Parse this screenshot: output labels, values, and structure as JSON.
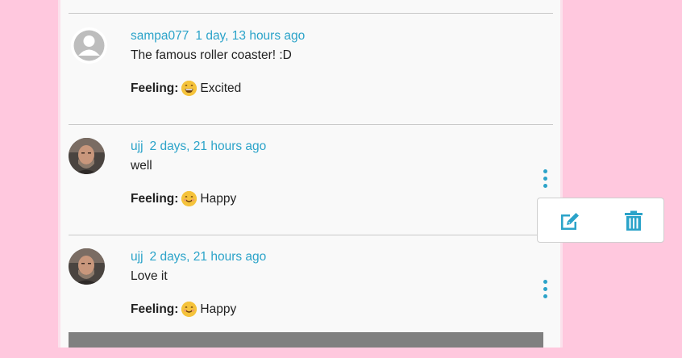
{
  "comments": [
    {
      "username": "sampa077",
      "time": "1 day, 13 hours ago",
      "text": "The famous roller coaster! :D",
      "feeling_label": "Feeling:",
      "feeling": "Excited",
      "emoji_icon": "grinning-face-icon",
      "avatar": "default-avatar-icon"
    },
    {
      "username": "ujj",
      "time": "2 days, 21 hours ago",
      "text": "well",
      "feeling_label": "Feeling:",
      "feeling": "Happy",
      "emoji_icon": "smiling-face-icon",
      "avatar": "user-photo"
    },
    {
      "username": "ujj",
      "time": "2 days, 21 hours ago",
      "text": "Love it",
      "feeling_label": "Feeling:",
      "feeling": "Happy",
      "emoji_icon": "smiling-face-icon",
      "avatar": "user-photo"
    }
  ],
  "actions": {
    "edit_icon": "edit-icon",
    "delete_icon": "trash-icon"
  },
  "colors": {
    "page_background": "#ffc8de",
    "panel": "#f9f9f9",
    "accent": "#2ba3c9",
    "emoji": "#f5c33b"
  }
}
